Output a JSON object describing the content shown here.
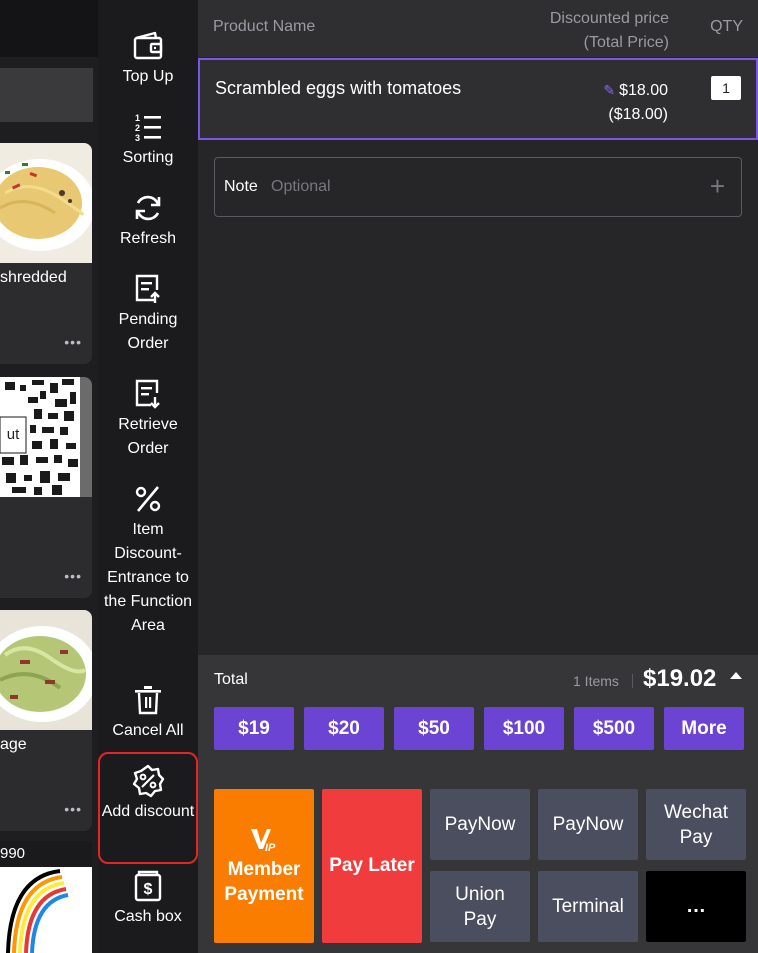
{
  "left_panel": {
    "cards": [
      {
        "name": "shredded",
        "more": "•••"
      },
      {
        "name": "",
        "overlay_text": "ut",
        "more": "•••"
      },
      {
        "name": "age",
        "more": "•••"
      }
    ],
    "bottom_label": "990"
  },
  "functions": [
    {
      "label": "Top Up",
      "icon": "wallet-icon"
    },
    {
      "label": "Sorting",
      "icon": "sorted-list-icon"
    },
    {
      "label": "Refresh",
      "icon": "refresh-icon"
    },
    {
      "label": "Pending Order",
      "icon": "pending-order-icon"
    },
    {
      "label": "Retrieve Order",
      "icon": "retrieve-order-icon"
    },
    {
      "label": "Item Discount-Entrance to the Function Area",
      "icon": "percent-icon"
    },
    {
      "label": "Cancel All",
      "icon": "trash-icon"
    },
    {
      "label": "Add discount",
      "icon": "discount-badge-icon"
    },
    {
      "label": "Cash box",
      "icon": "cash-box-icon"
    }
  ],
  "cart": {
    "header": {
      "product_name": "Product Name",
      "price_line1": "Discounted price",
      "price_line2": "(Total Price)",
      "qty": "QTY"
    },
    "items": [
      {
        "name": "Scrambled eggs with tomatoes",
        "price": "$18.00",
        "total": "($18.00)",
        "qty": "1"
      }
    ],
    "note": {
      "label": "Note",
      "placeholder": "Optional",
      "add": "+"
    }
  },
  "summary": {
    "total_label": "Total",
    "items_count": "1 Items",
    "total_amount": "$19.02"
  },
  "quick_amounts": [
    "$19",
    "$20",
    "$50",
    "$100",
    "$500",
    "More"
  ],
  "payments": {
    "member": "Member Payment",
    "later": "Pay Later",
    "paynow1": "PayNow",
    "paynow2": "PayNow",
    "wechat": "Wechat Pay",
    "union": "Union Pay",
    "terminal": "Terminal",
    "more": "…"
  },
  "colors": {
    "accent": "#6c44d4",
    "member": "#fa7d00",
    "pay_later": "#f03c3c",
    "highlight": "#e52525"
  }
}
